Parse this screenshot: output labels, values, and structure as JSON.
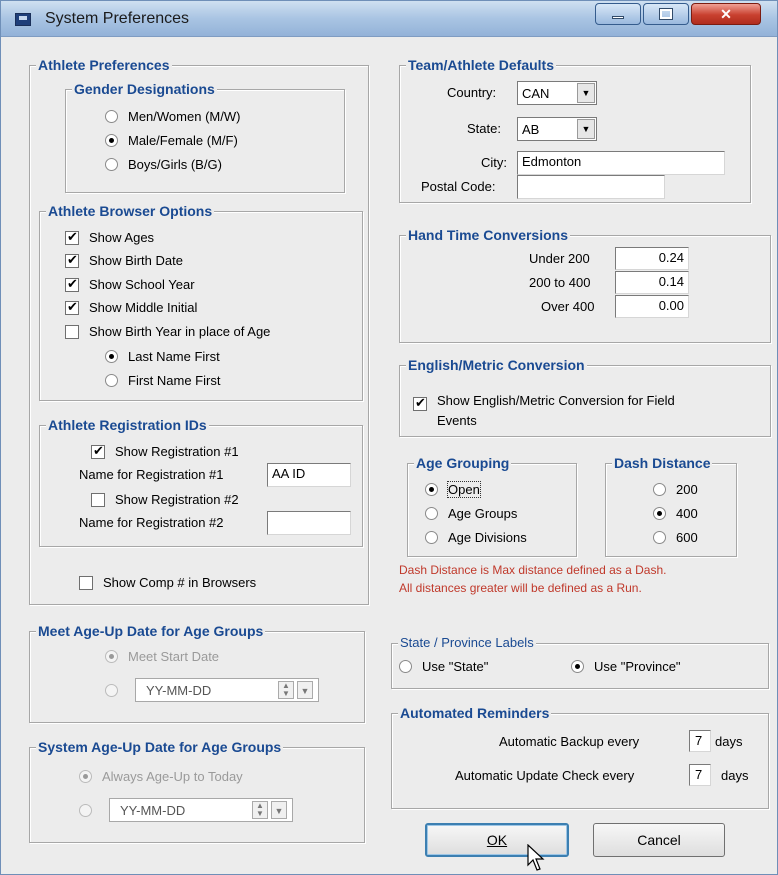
{
  "window": {
    "title": "System Preferences"
  },
  "athlete_prefs": {
    "title": "Athlete Preferences",
    "gender": {
      "title": "Gender Designations",
      "options": [
        "Men/Women (M/W)",
        "Male/Female (M/F)",
        "Boys/Girls (B/G)"
      ],
      "selected": 1
    },
    "browser": {
      "title": "Athlete Browser Options",
      "show_ages": "Show Ages",
      "show_birth_date": "Show Birth Date",
      "show_school_year": "Show School Year",
      "show_middle_initial": "Show Middle Initial",
      "show_birth_year": "Show Birth Year in place of Age",
      "last_name_first": "Last Name First",
      "first_name_first": "First Name First"
    },
    "registration": {
      "title": "Athlete Registration IDs",
      "show_reg1": "Show Registration #1",
      "name_reg1_label": "Name for Registration #1",
      "name_reg1_value": "AA ID",
      "show_reg2": "Show Registration #2",
      "name_reg2_label": "Name for Registration #2",
      "name_reg2_value": ""
    },
    "show_comp": "Show Comp # in Browsers"
  },
  "meet_ageup": {
    "title": "Meet Age-Up Date for Age Groups",
    "start_date": "Meet Start Date",
    "date_placeholder": "YY-MM-DD"
  },
  "system_ageup": {
    "title": "System Age-Up Date for Age Groups",
    "today": "Always Age-Up to Today",
    "date_placeholder": "YY-MM-DD"
  },
  "team_defaults": {
    "title": "Team/Athlete Defaults",
    "country_label": "Country:",
    "country": "CAN",
    "state_label": "State:",
    "state": "AB",
    "city_label": "City:",
    "city": "Edmonton",
    "postal_label": "Postal Code:",
    "postal": ""
  },
  "hand_time": {
    "title": "Hand Time Conversions",
    "rows": [
      {
        "label": "Under 200",
        "value": "0.24"
      },
      {
        "label": "200 to 400",
        "value": "0.14"
      },
      {
        "label": "Over 400",
        "value": "0.00"
      }
    ]
  },
  "metric": {
    "title": "English/Metric Conversion",
    "label_line1": "Show English/Metric Conversion for Field",
    "label_line2": "Events"
  },
  "age_grouping": {
    "title": "Age Grouping",
    "options": [
      "Open",
      "Age Groups",
      "Age Divisions"
    ],
    "selected": 0
  },
  "dash": {
    "title": "Dash Distance",
    "options": [
      "200",
      "400",
      "600"
    ],
    "selected": 1,
    "note1": "Dash Distance is Max distance defined as a Dash.",
    "note2": "All distances greater will be defined as a Run."
  },
  "state_labels": {
    "title": "State / Province Labels",
    "opt_state": "Use \"State\"",
    "opt_province": "Use \"Province\""
  },
  "reminders": {
    "title": "Automated Reminders",
    "backup_label": "Automatic Backup every",
    "backup_value": "7",
    "backup_unit": "days",
    "update_label": "Automatic Update Check every",
    "update_value": "7",
    "update_unit": "days"
  },
  "buttons": {
    "ok": "OK",
    "cancel": "Cancel"
  },
  "colors": {
    "group_title": "#1a4a92",
    "note_red": "#c0392b",
    "default_button_border": "#3c7fb1"
  }
}
